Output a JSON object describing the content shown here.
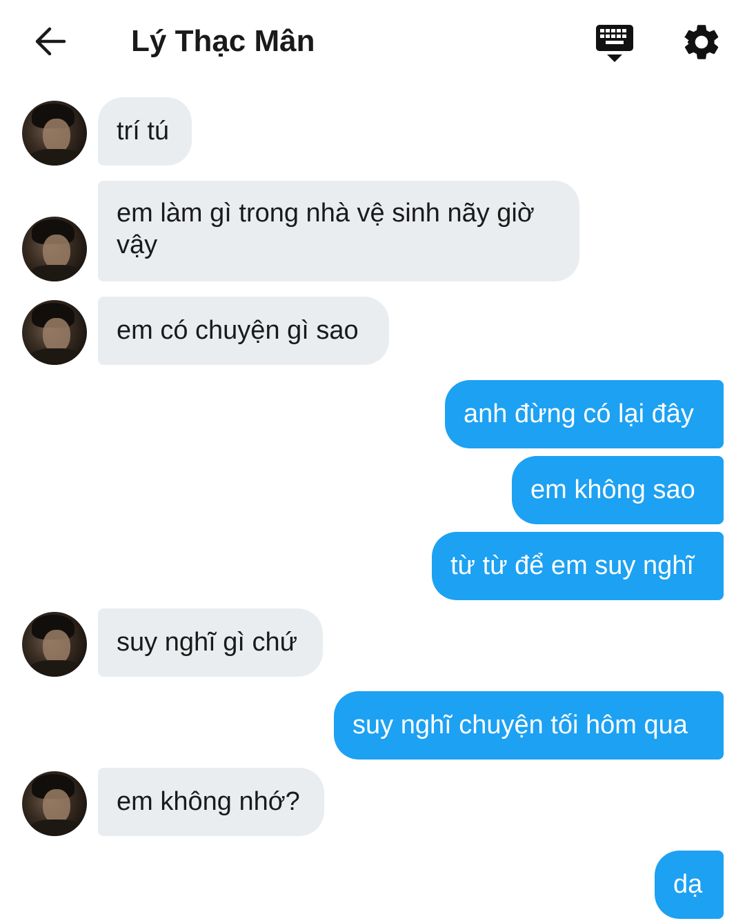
{
  "header": {
    "title": "Lý Thạc Mân",
    "back_icon": "arrow-left-icon",
    "keyboard_icon": "keyboard-hide-icon",
    "settings_icon": "gear-icon"
  },
  "colors": {
    "incoming_bubble": "#e9edf0",
    "outgoing_bubble": "#1da1f2",
    "incoming_text": "#1a1a1a",
    "outgoing_text": "#ffffff"
  },
  "messages": [
    {
      "direction": "in",
      "text": "trí tú"
    },
    {
      "direction": "in",
      "text": "em làm gì trong nhà vệ sinh nãy giờ vậy"
    },
    {
      "direction": "in",
      "text": "em có chuyện gì sao"
    },
    {
      "direction": "out",
      "text": "anh đừng có lại đây"
    },
    {
      "direction": "out",
      "text": "em không sao"
    },
    {
      "direction": "out",
      "text": "từ từ để em suy nghĩ"
    },
    {
      "direction": "in",
      "text": "suy nghĩ gì chứ"
    },
    {
      "direction": "out",
      "text": "suy nghĩ chuyện tối hôm qua"
    },
    {
      "direction": "in",
      "text": "em không nhớ?"
    },
    {
      "direction": "out",
      "text": "dạ"
    }
  ]
}
